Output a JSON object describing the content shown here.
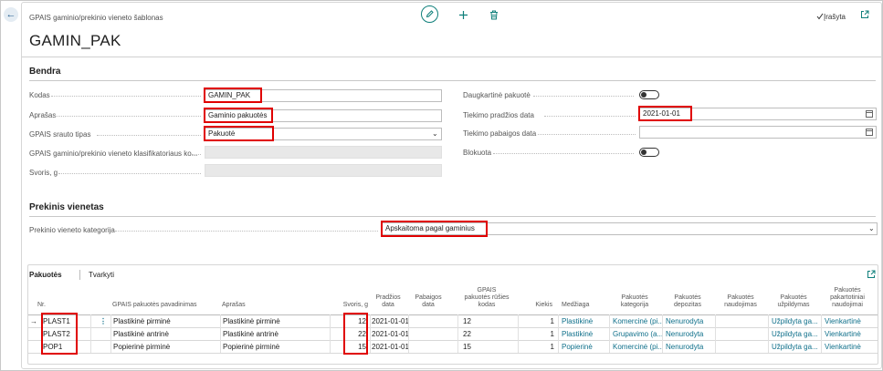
{
  "header": {
    "caption": "GPAIS gaminio/prekinio vieneto šablonas",
    "title": "GAMIN_PAK",
    "saved_label": "Įrašyta",
    "icons": {
      "back": "back-arrow-icon",
      "edit": "pencil-icon",
      "new": "plus-icon",
      "delete": "trash-icon",
      "saved": "checkmark-icon",
      "popout": "open-in-new-window-icon"
    }
  },
  "general": {
    "section_title": "Bendra",
    "code_label": "Kodas",
    "code_value": "GAMIN_PAK",
    "description_label": "Aprašas",
    "description_value": "Gaminio pakuotės",
    "flow_type_label": "GPAIS srauto tipas",
    "flow_type_value": "Pakuotė",
    "classifier_label": "GPAIS gaminio/prekinio vieneto klasifikatoriaus ko...",
    "weight_label": "Svoris, g",
    "multiple_package_label": "Daugkartinė pakuotė",
    "supply_start_label": "Tiekimo pradžios data",
    "supply_start_value": "2021-01-01",
    "supply_end_label": "Tiekimo pabaigos data",
    "supply_end_value": "",
    "blocked_label": "Blokuota"
  },
  "trade_unit": {
    "section_title": "Prekinis vienetas",
    "category_label": "Prekinio vieneto kategorija",
    "category_value": "Apskaitoma pagal gaminius"
  },
  "lines": {
    "tab_packages": "Pakuotės",
    "tab_manage": "Tvarkyti",
    "columns": {
      "nr": "Nr.",
      "package_name": "GPAIS pakuotės pavadinimas",
      "description": "Aprašas",
      "weight": "Svoris, g",
      "start_date": [
        "Pradžios",
        "data"
      ],
      "end_date": [
        "Pabaigos",
        "data"
      ],
      "package_type_code": [
        "GPAIS",
        "pakuotės rūšies",
        "kodas"
      ],
      "quantity": "Kiekis",
      "material": "Medžiaga",
      "package_category": [
        "Pakuotės",
        "kategorija"
      ],
      "deposit": [
        "Pakuotės",
        "depozitas"
      ],
      "usage": [
        "Pakuotės",
        "naudojimas"
      ],
      "filling": [
        "Pakuotės",
        "užpildymas"
      ],
      "reuse": [
        "Pakuotės",
        "pakartotiniai",
        "naudojimai"
      ]
    },
    "rows": [
      {
        "nr": "PLAST1",
        "package_name": "Plastikinė pirminė",
        "description": "Plastikinė pirminė",
        "weight": "12",
        "start_date": "2021-01-01",
        "end_date": "",
        "type_code": "12",
        "quantity": "1",
        "material": "Plastikinė",
        "category": "Komercinė (pi...",
        "deposit": "Nenurodyta",
        "usage": "",
        "filling": "Užpildyta ga...",
        "reuse": "Vienkartinė"
      },
      {
        "nr": "PLAST2",
        "package_name": "Plastikinė antrinė",
        "description": "Plastikinė antrinė",
        "weight": "22",
        "start_date": "2021-01-01",
        "end_date": "",
        "type_code": "22",
        "quantity": "1",
        "material": "Plastikinė",
        "category": "Grupavimo (a...",
        "deposit": "Nenurodyta",
        "usage": "",
        "filling": "Užpildyta ga...",
        "reuse": "Vienkartinė"
      },
      {
        "nr": "POP1",
        "package_name": "Popierinė pirminė",
        "description": "Popierinė pirminė",
        "weight": "15",
        "start_date": "2021-01-01",
        "end_date": "",
        "type_code": "15",
        "quantity": "1",
        "material": "Popierinė",
        "category": "Komercinė (pi...",
        "deposit": "Nenurodyta",
        "usage": "",
        "filling": "Užpildyta ga...",
        "reuse": "Vienkartinė"
      }
    ]
  }
}
